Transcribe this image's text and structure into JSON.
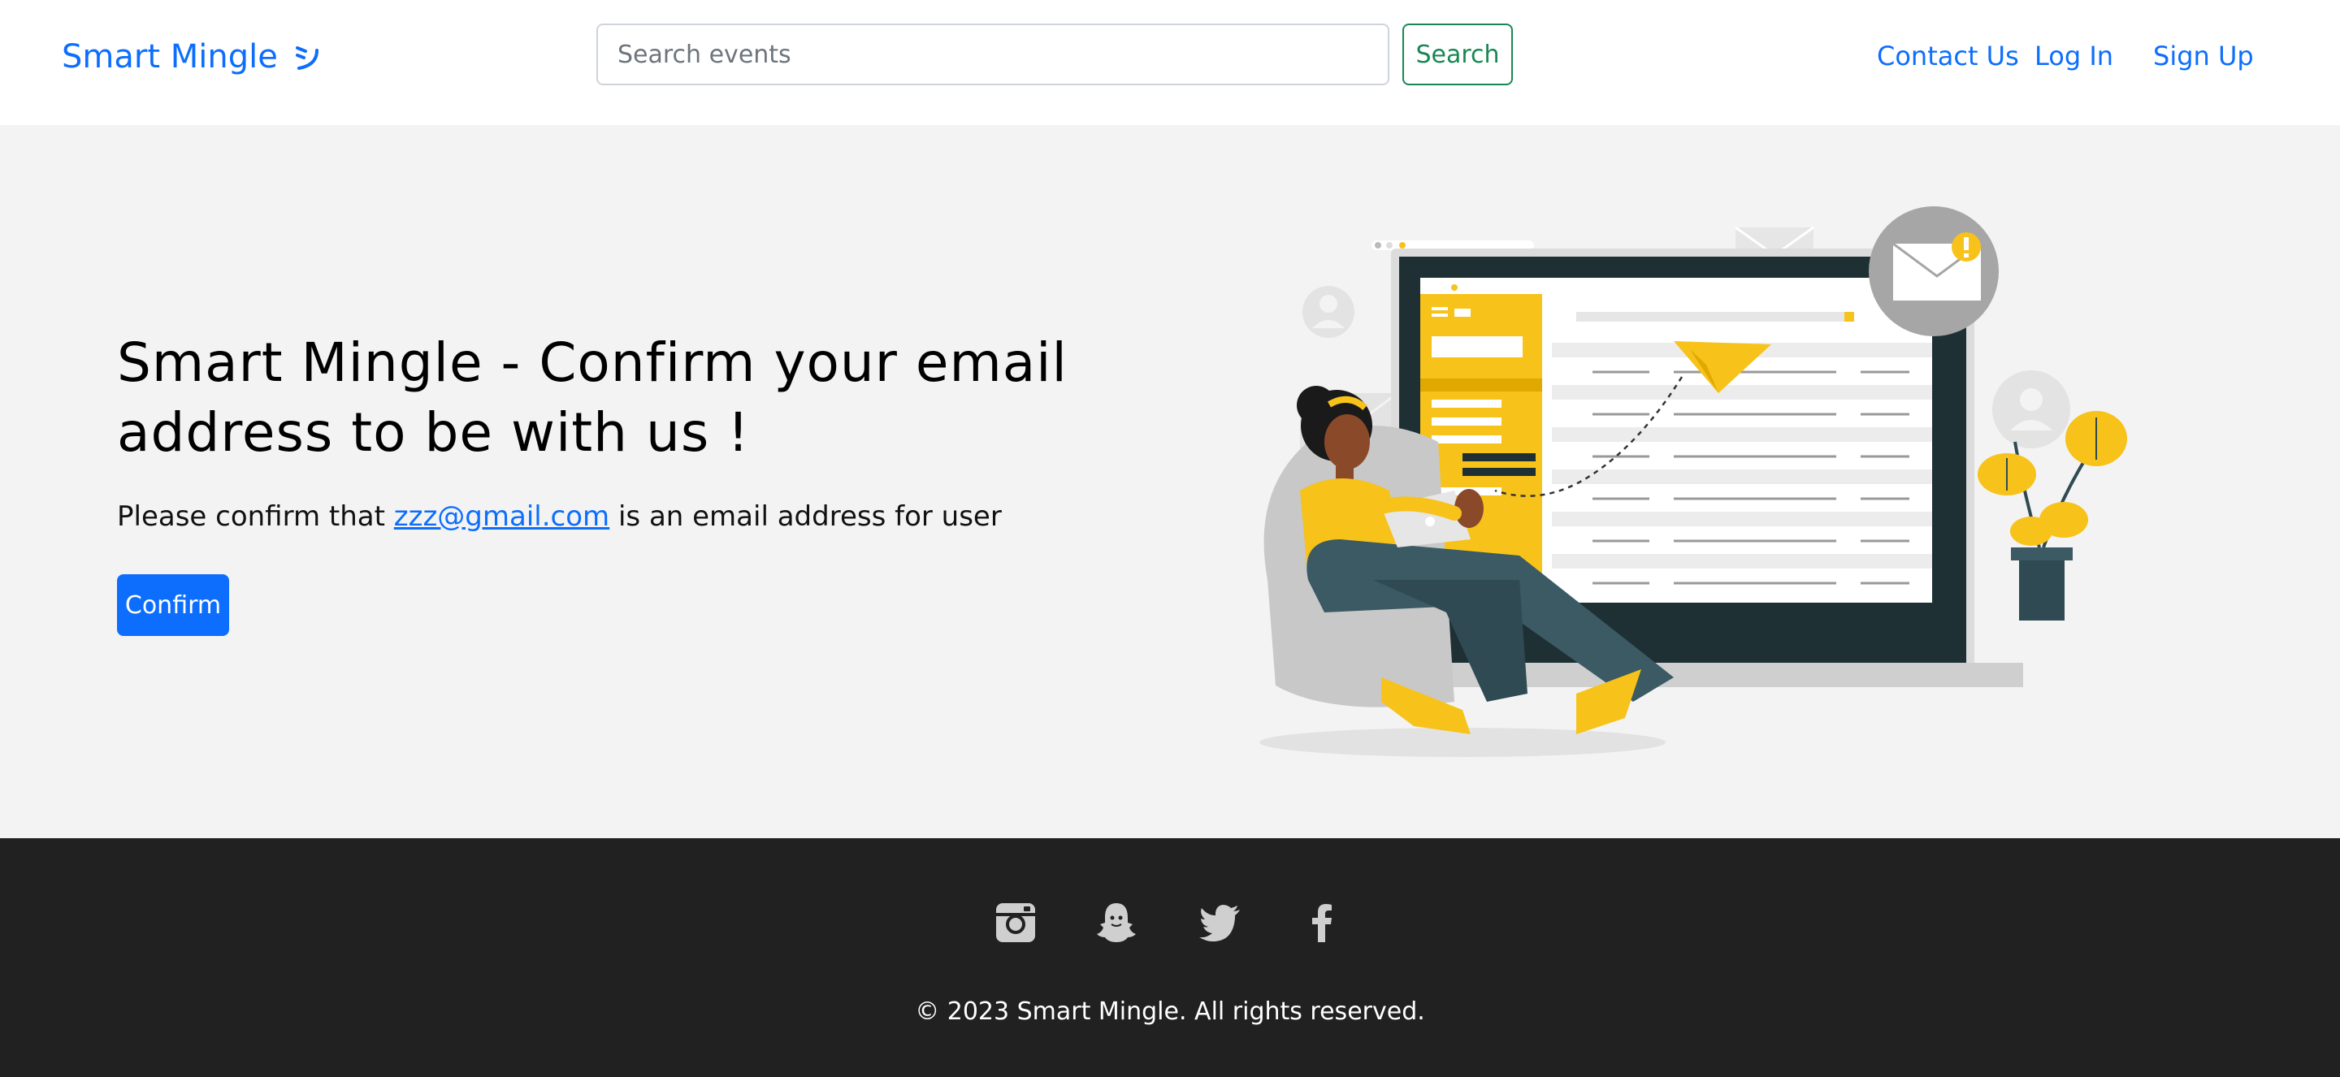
{
  "navbar": {
    "brand": "Smart Mingle",
    "brand_icon": "smile-icon",
    "search": {
      "placeholder": "Search events",
      "value": ""
    },
    "search_button": "Search",
    "links": {
      "contact": "Contact Us",
      "login": "Log In",
      "signup": "Sign Up"
    }
  },
  "hero": {
    "title": "Smart Mingle - Confirm your email address to be with us !",
    "text_before": "Please confirm that ",
    "email": "zzz@gmail.com",
    "text_after": " is an email address for user",
    "confirm_button": "Confirm",
    "illustration": "woman-with-laptop-email-illustration"
  },
  "footer": {
    "social_icons": [
      "instagram-icon",
      "snapchat-icon",
      "twitter-icon",
      "facebook-icon"
    ],
    "copyright": "© 2023 Smart Mingle. All rights reserved."
  },
  "colors": {
    "primary": "#0d6efd",
    "success": "#198754",
    "hero_bg": "#f3f3f3",
    "footer_bg": "#212121",
    "accent_yellow": "#f7c21a"
  }
}
